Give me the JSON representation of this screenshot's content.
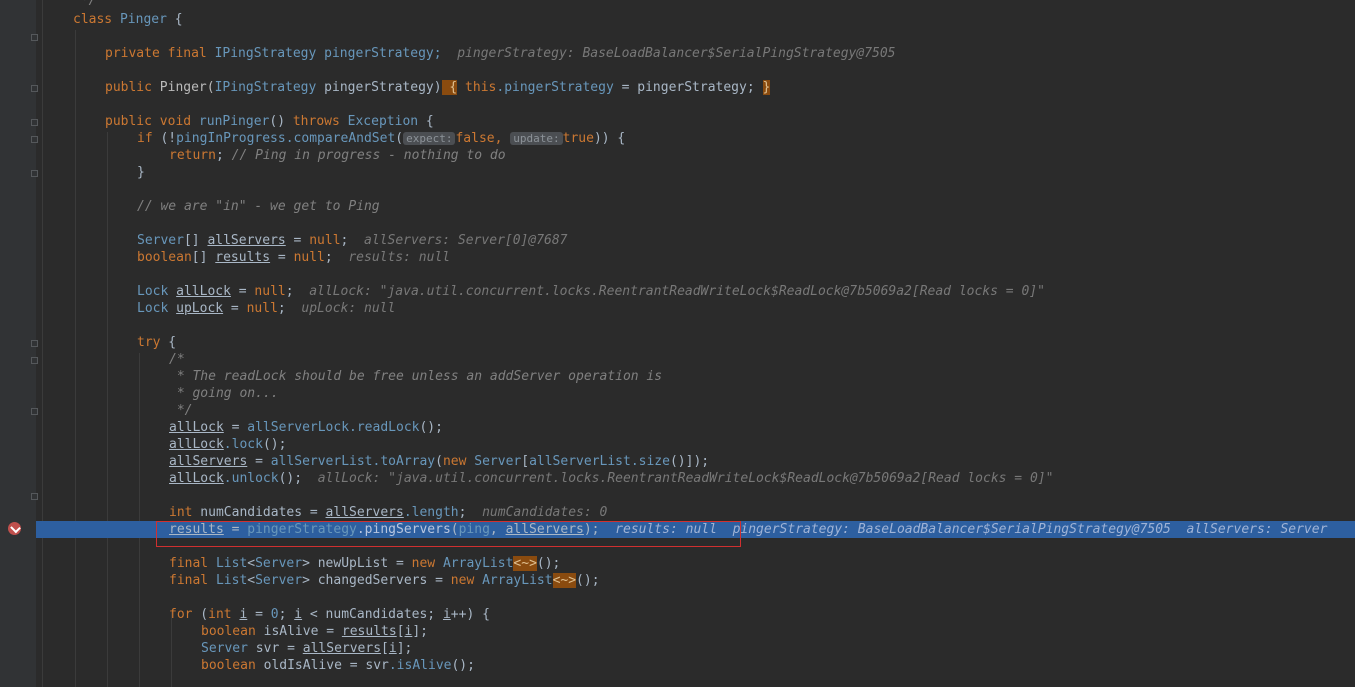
{
  "code": {
    "l01": " */",
    "l02_kw": "class",
    "l02_name": "Pinger",
    "l02_rest": " {",
    "l03_kw": "private final",
    "l03_type": "IPingStrategy",
    "l03_rest": " pingerStrategy;",
    "l03_debug": "pingerStrategy: BaseLoadBalancer$SerialPingStrategy@7505",
    "l04_kw": "public",
    "l04_name": "Pinger(",
    "l04_type": "IPingStrategy",
    "l04_rest": " pingerStrategy)",
    "l04_brace1": " {",
    "l04_body_kw": " this",
    "l04_body_field": ".pingerStrategy",
    "l04_body_rest": " = pingerStrategy; ",
    "l04_brace2": "}",
    "l05_kw": "public void",
    "l05_fn": "runPinger",
    "l05_mid": "()",
    "l05_kw2": "throws",
    "l05_type": "Exception",
    "l05_rest": " {",
    "l06_kw": "if",
    "l06_a": " (!",
    "l06_field": "pingInProgress",
    "l06_fn": ".compareAndSet",
    "l06_p": "(",
    "l06_hint1": "expect:",
    "l06_v1": "false,",
    "l06_hint2": "update:",
    "l06_v2": "true",
    "l06_end": ")) {",
    "l07_kw": "return",
    "l07_semi": ";",
    "l07_cm": " // Ping in progress - nothing to do",
    "l08": "}",
    "l09_cm": "// we are \"in\" - we get to Ping",
    "l10_type": "Server",
    "l10_a": "[] ",
    "l10_ref": "allServers",
    "l10_b": " = ",
    "l10_kw": "null",
    "l10_c": ";",
    "l10_debug": "allServers: Server[0]@7687",
    "l11_kw": "boolean",
    "l11_a": "[] ",
    "l11_ref": "results",
    "l11_b": " = ",
    "l11_kw2": "null",
    "l11_c": ";",
    "l11_debug": "results: null",
    "l12_type": "Lock",
    "l12_ref": "allLock",
    "l12_b": " = ",
    "l12_kw": "null",
    "l12_c": ";",
    "l12_debug": "allLock: \"java.util.concurrent.locks.ReentrantReadWriteLock$ReadLock@7b5069a2[Read locks = 0]\"",
    "l13_type": "Lock",
    "l13_ref": "upLock",
    "l13_b": " = ",
    "l13_kw": "null",
    "l13_c": ";",
    "l13_debug": "upLock: null",
    "l14_kw": "try",
    "l14_rest": " {",
    "l15": "/*",
    "l16": " * The readLock should be free unless an addServer operation is",
    "l17": " * going on...",
    "l18": " */",
    "l19_ref": "allLock",
    "l19_a": " = ",
    "l19_field": "allServerLock",
    "l19_fn": ".readLock",
    "l19_b": "();",
    "l20_ref": "allLock",
    "l20_fn": ".lock",
    "l20_b": "();",
    "l21_ref": "allServers",
    "l21_a": " = ",
    "l21_field": "allServerList",
    "l21_fn": ".toArray",
    "l21_b": "(",
    "l21_kw": "new",
    "l21_type": " Server",
    "l21_c": "[",
    "l21_field2": "allServerList",
    "l21_fn2": ".size",
    "l21_d": "()]);",
    "l22_ref": "allLock",
    "l22_fn": ".unlock",
    "l22_b": "();",
    "l22_debug": "allLock: \"java.util.concurrent.locks.ReentrantReadWriteLock$ReadLock@7b5069a2[Read locks = 0]\"",
    "l23_kw": "int",
    "l23_a": " numCandidates = ",
    "l23_ref": "allServers",
    "l23_field": ".length",
    "l23_b": ";",
    "l23_debug": "numCandidates: 0",
    "l24_ref": "results",
    "l24_a": " = ",
    "l24_field": "pingerStrategy",
    "l24_fn": ".pingServers",
    "l24_b": "(",
    "l24_field2": "ping",
    "l24_c": ", ",
    "l24_ref2": "allServers",
    "l24_d": ");",
    "l24_debug1": "results: null",
    "l24_debug2": "pingerStrategy: BaseLoadBalancer$SerialPingStrategy@7505",
    "l24_debug3": "allServers: Server",
    "l25_kw": "final",
    "l25_type": "List",
    "l25_a": "<",
    "l25_type2": "Server",
    "l25_b": "> newUpList = ",
    "l25_kw2": "new",
    "l25_type3": "ArrayList",
    "l25_diamond": "<~>",
    "l25_c": "();",
    "l26_kw": "final",
    "l26_type": "List",
    "l26_a": "<",
    "l26_type2": "Server",
    "l26_b": "> changedServers = ",
    "l26_kw2": "new",
    "l26_type3": "ArrayList",
    "l26_diamond": "<~>",
    "l26_c": "();",
    "l27_kw": "for",
    "l27_a": " (",
    "l27_kw2": "int",
    "l27_ref": "i",
    "l27_b": " = ",
    "l27_num": "0",
    "l27_c": "; ",
    "l27_ref2": "i",
    "l27_d": " < numCandidates; ",
    "l27_ref3": "i",
    "l27_e": "++) {",
    "l28_kw": "boolean",
    "l28_a": " isAlive = ",
    "l28_ref": "results",
    "l28_b": "[",
    "l28_ref2": "i",
    "l28_c": "];",
    "l29_type": "Server",
    "l29_a": " svr = ",
    "l29_ref": "allServers",
    "l29_b": "[",
    "l29_ref2": "i",
    "l29_c": "];",
    "l30_kw": "boolean",
    "l30_a": " oldIsAlive = svr",
    "l30_fn": ".isAlive",
    "l30_b": "();"
  },
  "colors": {
    "background": "#2b2b2b",
    "keyword": "#cc7832",
    "type": "#6897bb",
    "comment": "#808080",
    "highlight": "#2d5fa0",
    "breakpoint": "#c0504d"
  }
}
